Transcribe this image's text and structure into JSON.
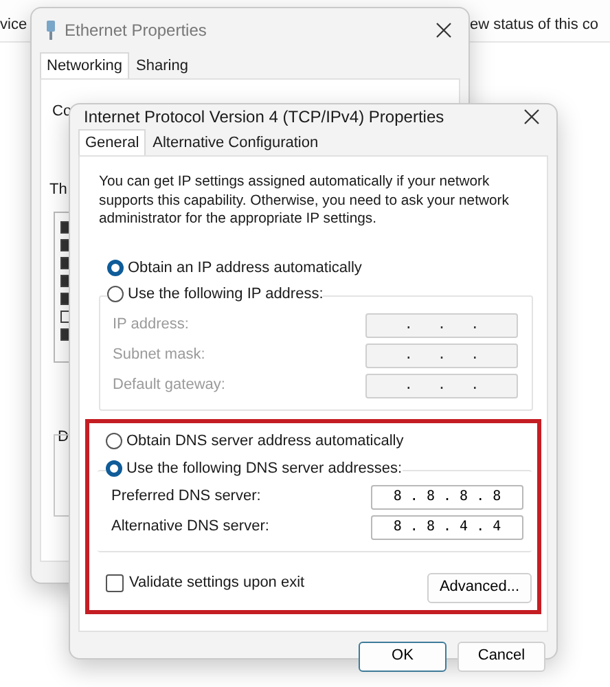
{
  "background": {
    "texts": [
      "vice",
      "ew status of this co"
    ]
  },
  "back_window": {
    "title": "Ethernet Properties",
    "tabs": [
      {
        "label": "Networking",
        "selected": true
      },
      {
        "label": "Sharing",
        "selected": false
      }
    ],
    "texts": [
      "Co",
      "Th",
      "D"
    ],
    "components": [
      {
        "checked": true
      },
      {
        "checked": true
      },
      {
        "checked": true
      },
      {
        "checked": true
      },
      {
        "checked": true
      },
      {
        "checked": false
      },
      {
        "checked": true
      }
    ]
  },
  "dialog": {
    "title": "Internet Protocol Version 4 (TCP/IPv4) Properties",
    "tabs": [
      {
        "label": "General",
        "selected": true
      },
      {
        "label": "Alternative Configuration",
        "selected": false
      }
    ],
    "description": "You can get IP settings assigned automatically if your network supports this capability. Otherwise, you need to ask your network administrator for the appropriate IP settings.",
    "ip_options": [
      {
        "label": "Obtain an IP address automatically",
        "selected": true
      },
      {
        "label": "Use the following IP address:",
        "selected": false
      }
    ],
    "ip_fields": [
      {
        "label": "IP address:",
        "value": ".   .   .",
        "disabled": true
      },
      {
        "label": "Subnet mask:",
        "value": ".   .   .",
        "disabled": true
      },
      {
        "label": "Default gateway:",
        "value": ".   .   .",
        "disabled": true
      }
    ],
    "dns_options": [
      {
        "label": "Obtain DNS server address automatically",
        "selected": false
      },
      {
        "label": "Use the following DNS server addresses:",
        "selected": true
      }
    ],
    "dns_fields": [
      {
        "label": "Preferred DNS server:",
        "value": "8 . 8 . 8 . 8",
        "disabled": false
      },
      {
        "label": "Alternative DNS server:",
        "value": "8 . 8 . 4 . 4",
        "disabled": false
      }
    ],
    "validate": {
      "label": "Validate settings upon exit",
      "checked": false
    },
    "advanced_button": "Advanced...",
    "buttons": [
      {
        "label": "OK",
        "default": true
      },
      {
        "label": "Cancel",
        "default": false
      }
    ]
  }
}
